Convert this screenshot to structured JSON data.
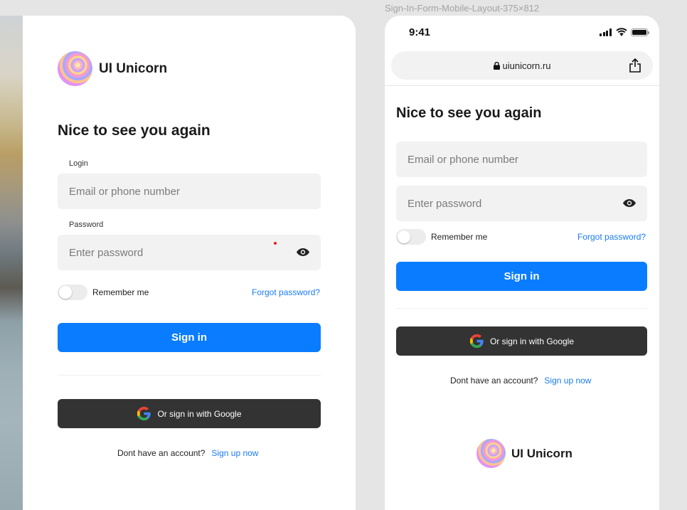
{
  "brand": {
    "name": "UI Unicorn"
  },
  "desktop": {
    "heading": "Nice to see you again",
    "login_label": "Login",
    "email_placeholder": "Email or phone number",
    "password_label": "Password",
    "password_placeholder": "Enter password",
    "remember_label": "Remember me",
    "forgot_label": "Forgot password?",
    "signin_label": "Sign in",
    "google_label": "Or sign in with Google",
    "no_account_text": "Dont have an account?",
    "signup_label": "Sign up now"
  },
  "mobile": {
    "frame_title": "Sign-In-Form-Mobile-Layout-375×812",
    "status_time": "9:41",
    "url": "uiunicorn.ru",
    "heading": "Nice to see you again",
    "email_placeholder": "Email or phone number",
    "password_placeholder": "Enter password",
    "remember_label": "Remember me",
    "forgot_label": "Forgot password?",
    "signin_label": "Sign in",
    "google_label": "Or sign in with Google",
    "no_account_text": "Dont have an account?",
    "signup_label": "Sign up now"
  },
  "colors": {
    "primary": "#0a7cff",
    "google_button": "#333333",
    "link": "#1a7cf5",
    "input_bg": "#f2f2f2"
  },
  "icons": [
    "unicorn-logo-icon",
    "eye-icon",
    "google-icon",
    "lock-icon",
    "share-icon",
    "signal-icon",
    "wifi-icon",
    "battery-icon"
  ]
}
